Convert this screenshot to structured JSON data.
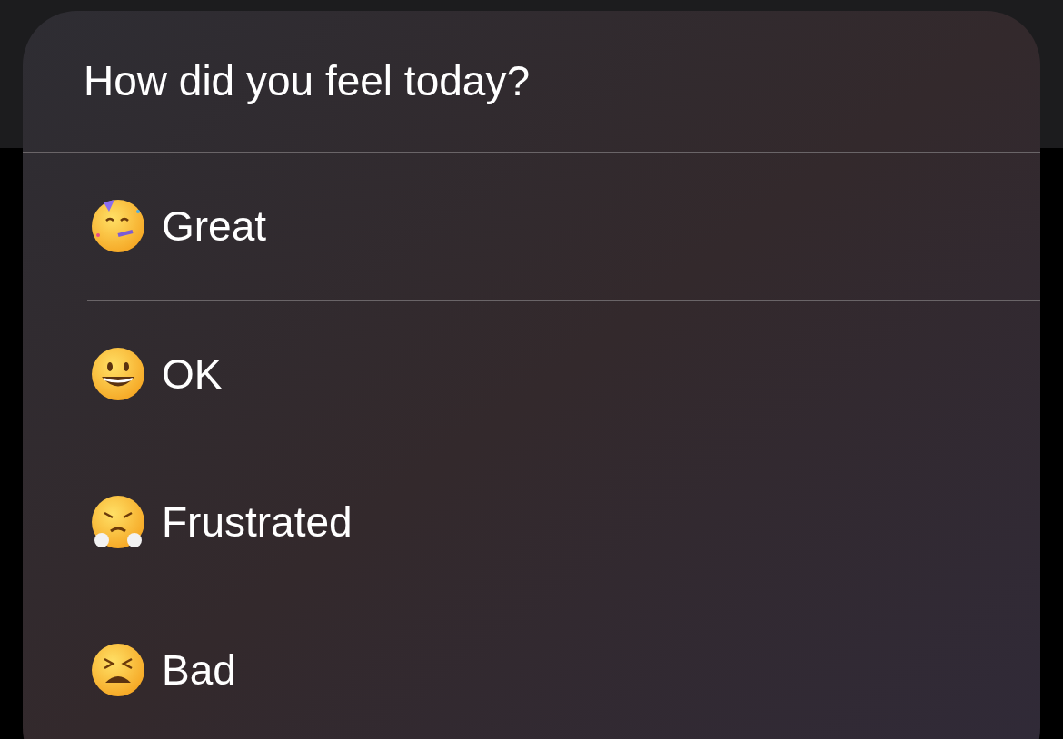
{
  "menu": {
    "title": "How did you feel today?",
    "items": [
      {
        "label": "Great"
      },
      {
        "label": "OK"
      },
      {
        "label": "Frustrated"
      },
      {
        "label": "Bad"
      }
    ]
  }
}
